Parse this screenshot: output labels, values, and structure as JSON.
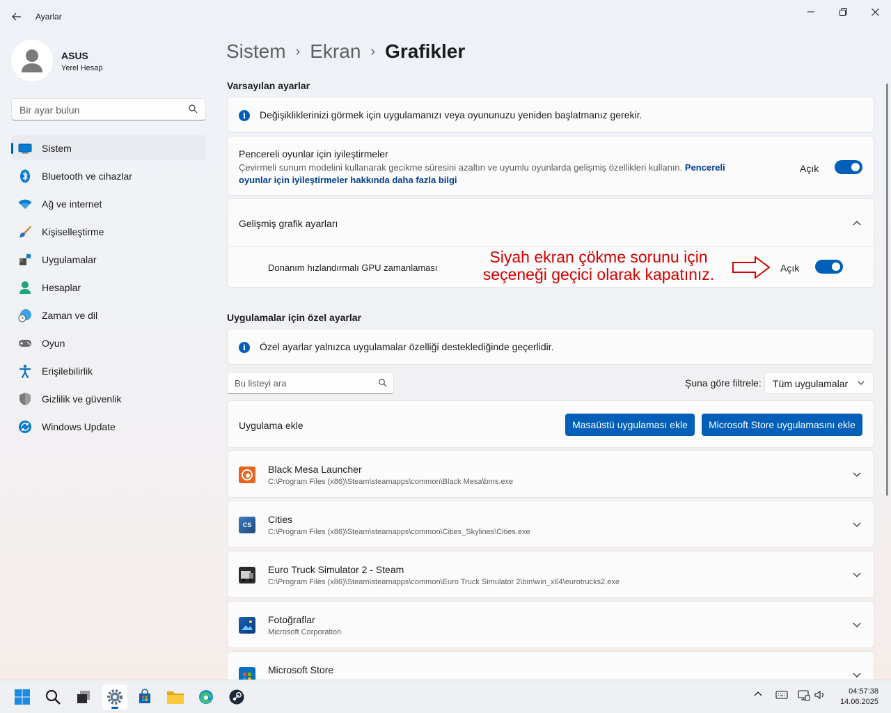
{
  "window": {
    "title": "Ayarlar"
  },
  "profile": {
    "name": "ASUS",
    "account": "Yerel Hesap"
  },
  "search": {
    "placeholder": "Bir ayar bulun"
  },
  "nav": {
    "items": [
      {
        "label": "Sistem",
        "icon": "monitor-icon",
        "active": true
      },
      {
        "label": "Bluetooth ve cihazlar",
        "icon": "bluetooth-icon"
      },
      {
        "label": "Ağ ve internet",
        "icon": "wifi-icon"
      },
      {
        "label": "Kişiselleştirme",
        "icon": "brush-icon"
      },
      {
        "label": "Uygulamalar",
        "icon": "apps-icon"
      },
      {
        "label": "Hesaplar",
        "icon": "person-icon"
      },
      {
        "label": "Zaman ve dil",
        "icon": "globe-clock-icon"
      },
      {
        "label": "Oyun",
        "icon": "gamepad-icon"
      },
      {
        "label": "Erişilebilirlik",
        "icon": "accessibility-icon"
      },
      {
        "label": "Gizlilik ve güvenlik",
        "icon": "shield-icon"
      },
      {
        "label": "Windows Update",
        "icon": "update-icon"
      }
    ]
  },
  "breadcrumb": {
    "level1": "Sistem",
    "level2": "Ekran",
    "current": "Grafikler",
    "separator": "›"
  },
  "defaults": {
    "title": "Varsayılan ayarlar",
    "info": "Değişikliklerinizi görmek için uygulamanızı veya oyununuzu yeniden başlatmanız gerekir.",
    "windowed": {
      "title": "Pencereli oyunlar için iyileştirmeler",
      "desc": "Çevirmeli sunum modelini kullanarak gecikme süresini azaltın ve uyumlu oyunlarda gelişmiş özellikleri kullanın.",
      "link_part1": "Pencereli",
      "link_part2": "oyunlar için iyileştirmeler hakkında daha fazla bilgi",
      "state": "Açık"
    },
    "advanced": {
      "title": "Gelişmiş grafik ayarları"
    },
    "gpu": {
      "label": "Donanım hızlandırmalı GPU zamanlaması",
      "state": "Açık"
    }
  },
  "annotation": {
    "line1": "Siyah ekran çökme sorunu için",
    "line2": "seçeneği geçici olarak kapatınız."
  },
  "custom": {
    "title": "Uygulamalar için özel ayarlar",
    "info": "Özel ayarlar yalnızca uygulamalar özelliği desteklediğinde geçerlidir.",
    "search_placeholder": "Bu listeyi ara",
    "filter_label": "Şuna göre filtrele:",
    "filter_value": "Tüm uygulamalar",
    "add_app": "Uygulama ekle",
    "btn_desktop": "Masaüstü uygulaması ekle",
    "btn_store": "Microsoft Store uygulamasını ekle",
    "apps": [
      {
        "name": "Black Mesa Launcher",
        "path": "C:\\Program Files (x86)\\Steam\\steamapps\\common\\Black Mesa\\bms.exe"
      },
      {
        "name": "Cities",
        "path": "C:\\Program Files (x86)\\Steam\\steamapps\\common\\Cities_Skylines\\Cities.exe"
      },
      {
        "name": "Euro Truck Simulator 2 - Steam",
        "path": "C:\\Program Files (x86)\\Steam\\steamapps\\common\\Euro Truck Simulator 2\\bin\\win_x64\\eurotrucks2.exe"
      },
      {
        "name": "Fotoğraflar",
        "path": "Microsoft Corporation"
      },
      {
        "name": "Microsoft Store",
        "path": ""
      }
    ]
  },
  "taskbar": {
    "time": "04:57:38",
    "date": "14.06.2025"
  },
  "colors": {
    "accent": "#005fb8",
    "annotation": "#d40000"
  }
}
